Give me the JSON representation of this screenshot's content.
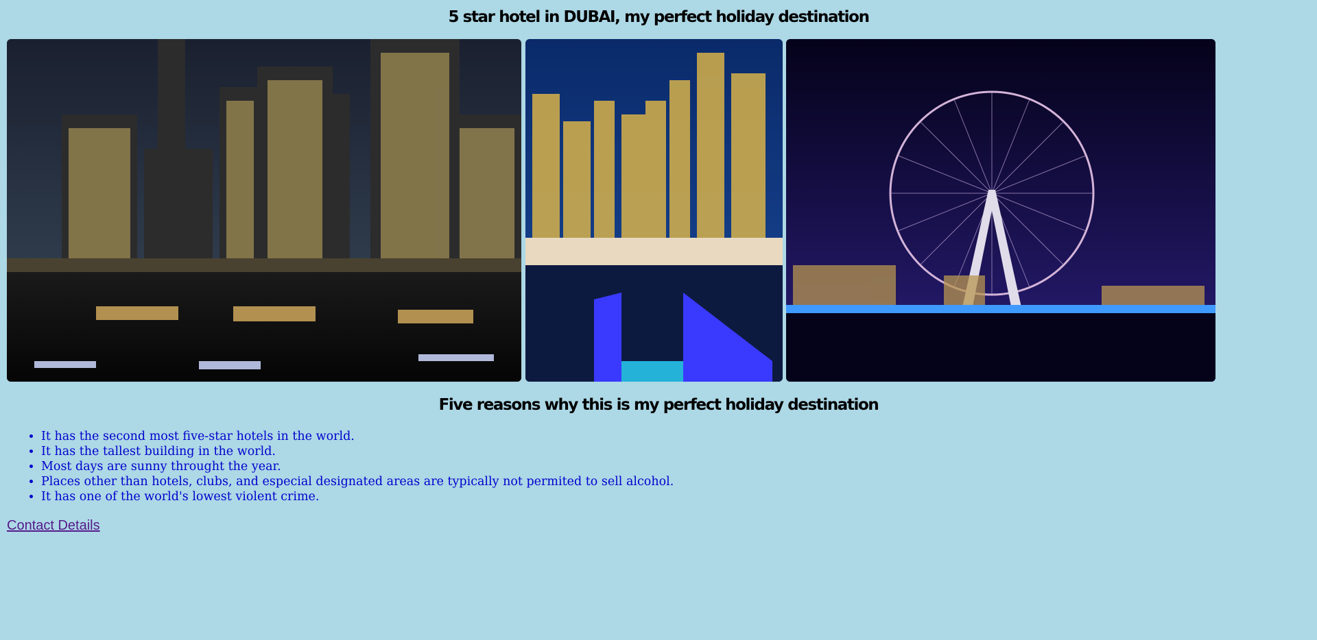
{
  "page": {
    "title": "5 star hotel in DUBAI, my perfect holiday destination",
    "subtitle": "Five reasons why this is my perfect holiday destination",
    "background_color": "#add8e6"
  },
  "gallery": {
    "images": [
      {
        "subject": "Dubai Marina skyline at night with boats"
      },
      {
        "subject": "Marina towers and yachts with blue-lit pier"
      },
      {
        "subject": "Ain Dubai observation wheel at night"
      }
    ]
  },
  "reasons": [
    "It has the second most five-star hotels in the world.",
    "It has the tallest building in the world.",
    "Most days are sunny throught the year.",
    "Places other than hotels, clubs, and especial designated areas are typically not permited to sell alcohol.",
    "It has one of the world's lowest violent crime."
  ],
  "contact_link": {
    "label": "Contact Details",
    "color": "#551a8b"
  },
  "colors": {
    "list_text": "#0000cd"
  }
}
